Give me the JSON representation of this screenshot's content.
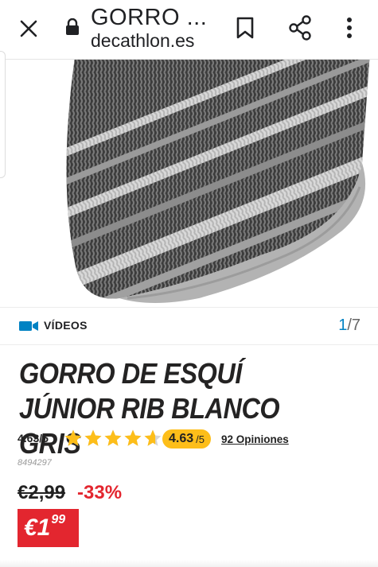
{
  "browser": {
    "title": "GORRO ...",
    "url": "decathlon.es"
  },
  "media": {
    "videos_label": "VÍDEOS",
    "current": "1",
    "total": "/7"
  },
  "product": {
    "title": "GORRO DE ESQUÍ JÚNIOR RIB BLANCO GRIS",
    "rating_text": "4.63/5",
    "rating_value": 4.63,
    "rating_max": 5,
    "badge_value": "4.63",
    "badge_max": "/5",
    "opinions": "92 Opiniones",
    "reference": "8494297",
    "old_price": "€2,99",
    "discount": "-33%",
    "price_main": "€1",
    "price_cents": "99"
  },
  "colors": {
    "accent": "#0082c3",
    "star": "#fdbe1a",
    "sale": "#e3262f"
  }
}
